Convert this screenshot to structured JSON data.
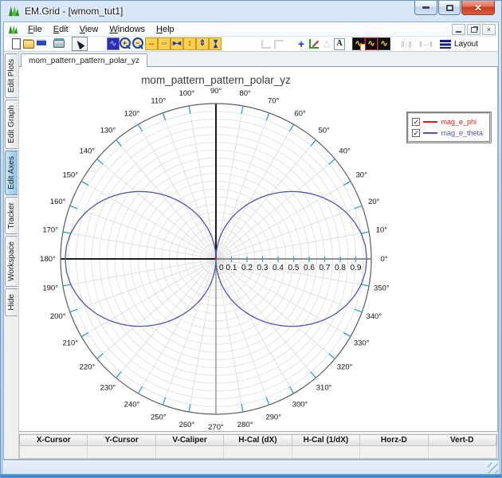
{
  "window": {
    "title": "EM.Grid - [wmom_tut1]"
  },
  "menu": {
    "items": [
      "File",
      "Edit",
      "View",
      "Windows",
      "Help"
    ]
  },
  "toolbar": {
    "buttons": [
      {
        "name": "new-document"
      },
      {
        "name": "open-file"
      },
      {
        "name": "save-file"
      },
      {
        "name": "print",
        "gap": "g6"
      },
      {
        "name": "pointer-tool",
        "selected": true,
        "gap": "g8"
      },
      {
        "name": "zoom-window",
        "glyph": "∿",
        "gap": "g24"
      },
      {
        "name": "zoom-in"
      },
      {
        "name": "zoom-out"
      },
      {
        "name": "expand-x",
        "glyph": "↔",
        "cls": "yellowbg red-glyph"
      },
      {
        "name": "scroll-x",
        "glyph": "⇔",
        "cls": "yellowbg blue-glyph"
      },
      {
        "name": "shrink-x",
        "glyph": "▸◂",
        "cls": "yellowbg blue-glyph"
      },
      {
        "name": "expand-y",
        "glyph": "↕",
        "cls": "yellowbg red-glyph"
      },
      {
        "name": "scroll-y",
        "glyph": "⇕",
        "cls": "yellowbg blue-glyph"
      },
      {
        "name": "shrink-y",
        "glyph": "▸◂",
        "cls": "yellowbg blue-glyph",
        "rotate": true
      },
      {
        "name": "frame-corner-bottom",
        "disabled": true,
        "gap": "g48"
      },
      {
        "name": "frame-corner-top",
        "disabled": true
      },
      {
        "name": "add-marker",
        "glyph": "+",
        "gap": "g12"
      },
      {
        "name": "axes-tool"
      },
      {
        "name": "add-shape",
        "glyph": "△",
        "disabled": true
      },
      {
        "name": "add-text"
      },
      {
        "name": "plot-marker-style",
        "glyph": "∿",
        "cls": "waveicon",
        "gap": "g8"
      },
      {
        "name": "plot-active-style",
        "glyph": "∿",
        "cls": "waveicon"
      },
      {
        "name": "plot-style",
        "glyph": "∿",
        "cls": "waveicon"
      },
      {
        "name": "distribute-vertical",
        "glyph": "↕",
        "disabled": true,
        "gap": "g12"
      },
      {
        "name": "distribute-horizontal",
        "glyph": "↔",
        "disabled": true,
        "gap": "g8"
      }
    ],
    "layout_label": "Layout"
  },
  "sidebar": {
    "tabs": [
      {
        "label": "Edit Plots",
        "active": false
      },
      {
        "label": "Edit Graph",
        "active": false
      },
      {
        "label": "Edit Axes",
        "active": true
      },
      {
        "label": "Tracker",
        "active": false
      },
      {
        "label": "Workspace",
        "active": false
      },
      {
        "label": "Hide",
        "active": false
      }
    ]
  },
  "document_tabs": [
    {
      "label": "mom_pattern_pattern_polar_yz",
      "active": true
    }
  ],
  "legend": {
    "entries": [
      {
        "label": "mag_e_phi",
        "color": "#cc2222",
        "checked": true
      },
      {
        "label": "mag_e_theta",
        "color": "#5252b2",
        "checked": true
      }
    ]
  },
  "chart_data": {
    "type": "polar",
    "title": "mom_pattern_pattern_polar_yz",
    "angle_labels": [
      "0°",
      "10°",
      "20°",
      "30°",
      "40°",
      "50°",
      "60°",
      "70°",
      "80°",
      "90°",
      "100°",
      "110°",
      "120°",
      "130°",
      "140°",
      "150°",
      "160°",
      "170°",
      "180°",
      "190°",
      "200°",
      "210°",
      "220°",
      "230°",
      "240°",
      "250°",
      "260°",
      "270°",
      "280°",
      "290°",
      "300°",
      "310°",
      "320°",
      "330°",
      "340°",
      "350°"
    ],
    "radial_labels": [
      "0",
      "0.1",
      "0.2",
      "0.3",
      "0.4",
      "0.5",
      "0.6",
      "0.7",
      "0.8",
      "0.9"
    ],
    "radial_max": 1.0,
    "grid": {
      "circle_step": 0.05,
      "spoke_step_deg": 10,
      "tick_color": "#2fa7a7"
    },
    "series": [
      {
        "name": "mag_e_phi",
        "color": "#cc2222",
        "r_constant": 0
      },
      {
        "name": "mag_e_theta",
        "color": "#5252b2",
        "symmetry": "mirrored across horizontal and vertical axes (lobes at 0° and 180°, nulls at 90° and 270°)",
        "profile_deg_r": [
          [
            0,
            0.97
          ],
          [
            5,
            0.965
          ],
          [
            10,
            0.949
          ],
          [
            15,
            0.922
          ],
          [
            20,
            0.887
          ],
          [
            25,
            0.843
          ],
          [
            30,
            0.792
          ],
          [
            35,
            0.735
          ],
          [
            40,
            0.674
          ],
          [
            45,
            0.609
          ],
          [
            50,
            0.542
          ],
          [
            55,
            0.474
          ],
          [
            60,
            0.405
          ],
          [
            65,
            0.337
          ],
          [
            70,
            0.269
          ],
          [
            75,
            0.201
          ],
          [
            80,
            0.134
          ],
          [
            85,
            0.066
          ],
          [
            90,
            0.0
          ]
        ]
      }
    ]
  },
  "statusbar": {
    "columns": [
      "X-Cursor",
      "Y-Cursor",
      "V-Caliper",
      "H-Cal (dX)",
      "H-Cal (1/dX)",
      "Horz-D",
      "Vert-D"
    ],
    "values": [
      "",
      "",
      "",
      "",
      "",
      "",
      ""
    ]
  }
}
